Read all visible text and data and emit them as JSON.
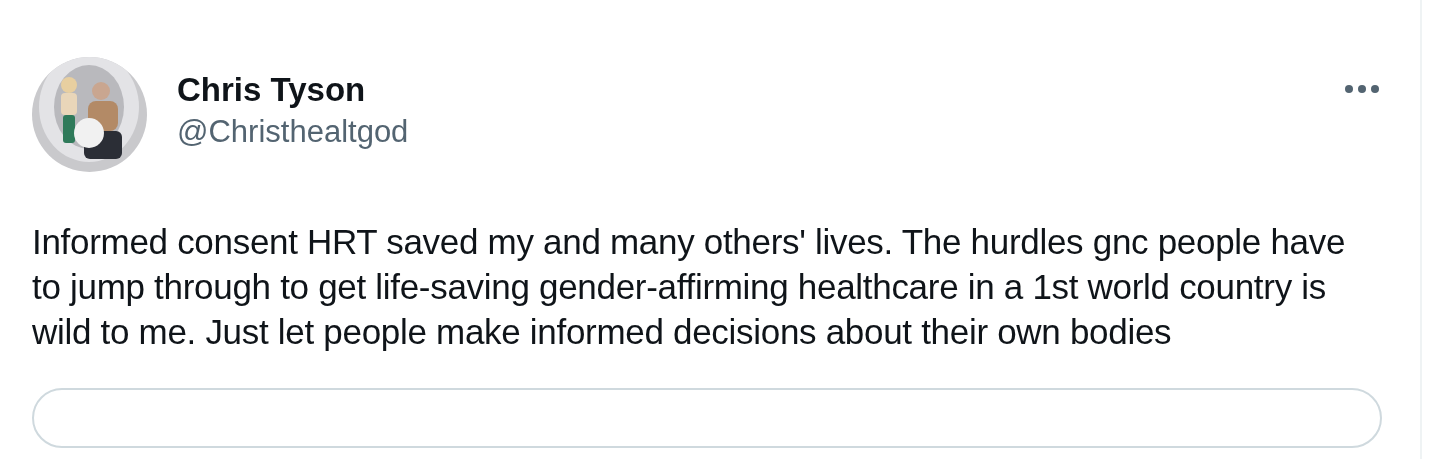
{
  "author": {
    "name": "Chris Tyson",
    "handle": "@Christhealtgod"
  },
  "post": {
    "text": "Informed consent HRT saved my and many others' lives. The hurdles gnc people have to jump through to get life-saving gender-affirming healthcare in a 1st world country is wild to me. Just let people make informed decisions about their own bodies"
  },
  "embedded_card": {
    "kind": "card"
  }
}
